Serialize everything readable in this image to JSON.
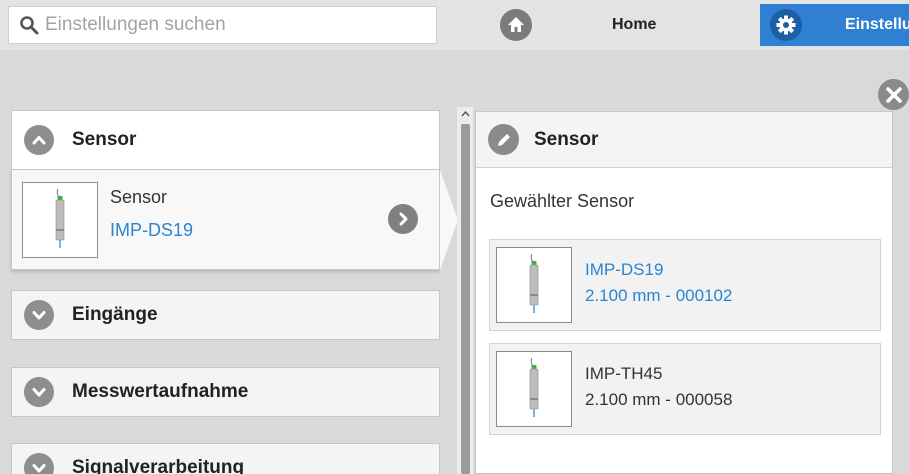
{
  "search": {
    "placeholder": "Einstellungen suchen"
  },
  "nav": {
    "home_label": "Home",
    "settings_label": "Einstellungen"
  },
  "left": {
    "sections": [
      {
        "title": "Sensor",
        "expanded": true
      },
      {
        "title": "Eingänge",
        "expanded": false
      },
      {
        "title": "Messwertaufnahme",
        "expanded": false
      },
      {
        "title": "Signalverarbeitung",
        "expanded": false
      }
    ],
    "sensor_item": {
      "label": "Sensor",
      "value": "IMP-DS19"
    }
  },
  "right": {
    "title": "Sensor",
    "subtitle": "Gewählter Sensor",
    "options": [
      {
        "name": "IMP-DS19",
        "detail": "2.100 mm - 000102",
        "selected": true
      },
      {
        "name": "IMP-TH45",
        "detail": "2.100 mm - 000058",
        "selected": false
      }
    ]
  },
  "colors": {
    "accent": "#2f7fd2",
    "link": "#2b84d0"
  },
  "icons": [
    "search-icon",
    "home-icon",
    "gear-icon",
    "close-icon",
    "chevron-up-icon",
    "chevron-down-icon",
    "chevron-right-icon",
    "pencil-icon",
    "sensor-probe-icon"
  ]
}
